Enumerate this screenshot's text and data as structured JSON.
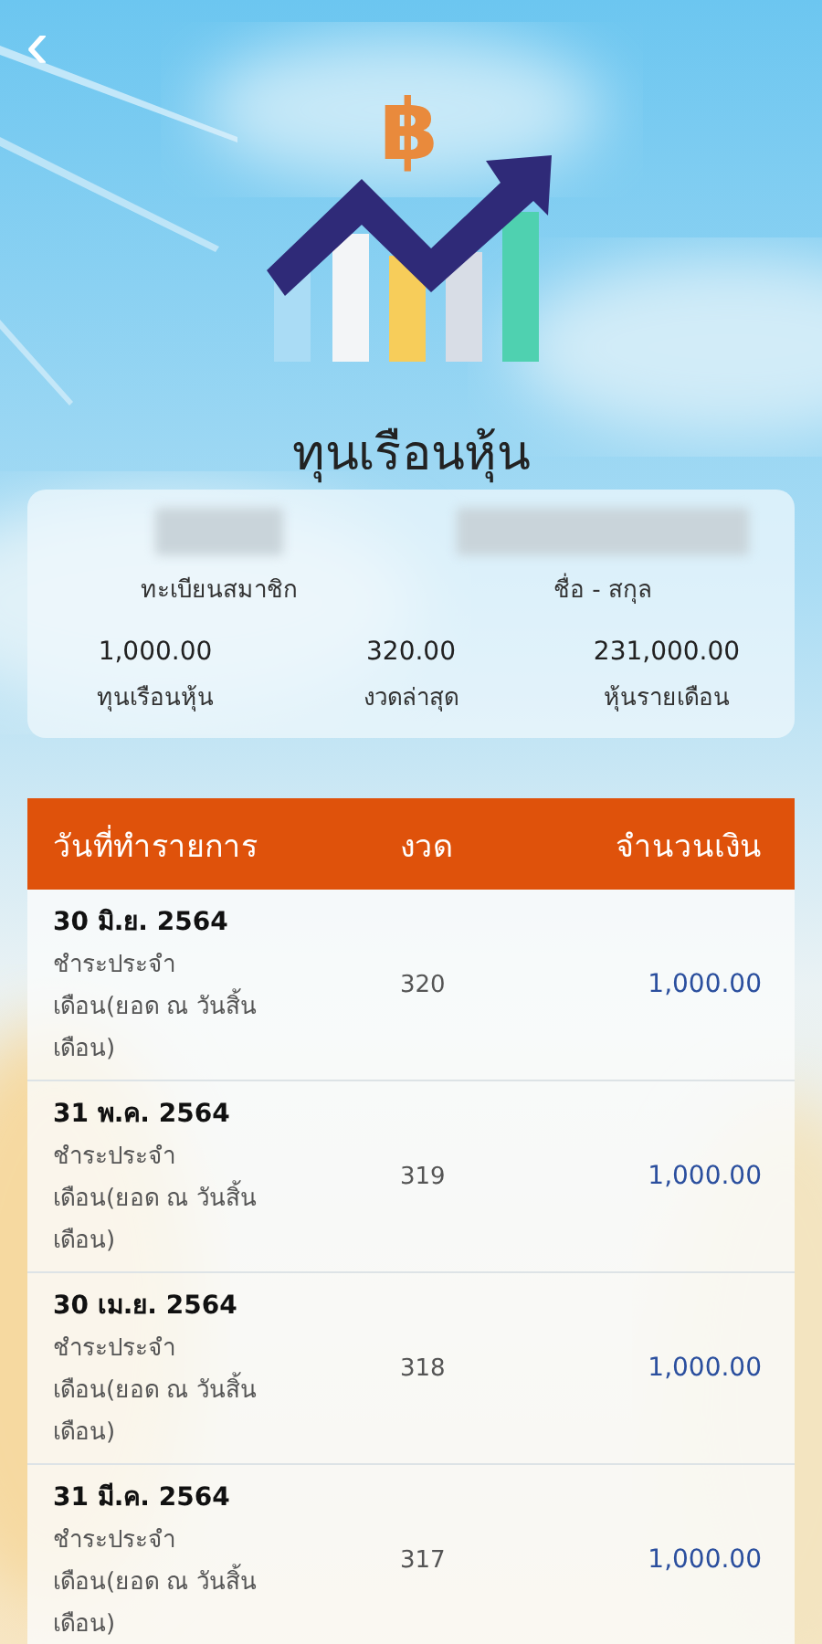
{
  "header": {
    "back": "‹",
    "logo_symbol": "฿",
    "title": "ทุนเรือนหุ้น"
  },
  "member": {
    "id": {
      "label": "ทะเบียนสมาชิก",
      "redacted": true
    },
    "name": {
      "label": "ชื่อ - สกุล",
      "redacted": true
    },
    "stats": [
      {
        "value": "1,000.00",
        "label": "ทุนเรือนหุ้น"
      },
      {
        "value": "320.00",
        "label": "งวดล่าสุด"
      },
      {
        "value": "231,000.00",
        "label": "หุ้นรายเดือน"
      }
    ]
  },
  "table": {
    "columns": [
      "วันที่ทำรายการ",
      "งวด",
      "จำนวนเงิน"
    ],
    "rows": [
      {
        "date": "30 มิ.ย. 2564",
        "description": "ชำระประจำเดือน(ยอด ณ วันสิ้นเดือน)",
        "period": "320",
        "amount": "1,000.00"
      },
      {
        "date": "31 พ.ค. 2564",
        "description": "ชำระประจำเดือน(ยอด ณ วันสิ้นเดือน)",
        "period": "319",
        "amount": "1,000.00"
      },
      {
        "date": "30 เม.ย. 2564",
        "description": "ชำระประจำเดือน(ยอด ณ วันสิ้นเดือน)",
        "period": "318",
        "amount": "1,000.00"
      },
      {
        "date": "31 มี.ค. 2564",
        "description": "ชำระประจำเดือน(ยอด ณ วันสิ้นเดือน)",
        "period": "317",
        "amount": "1,000.00"
      }
    ]
  }
}
